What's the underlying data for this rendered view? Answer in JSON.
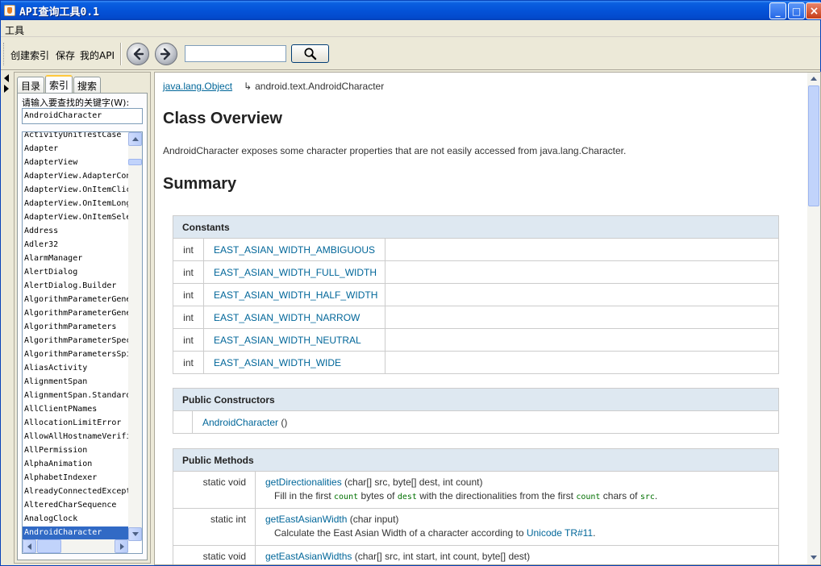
{
  "window": {
    "title": "API查询工具0.1",
    "min": "_",
    "max": "□",
    "close": "×"
  },
  "menu": {
    "tools": "工具"
  },
  "toolbar": {
    "build_index": "创建索引",
    "save": "保存",
    "my_api": "我的API",
    "search_value": ""
  },
  "sidebar": {
    "tabs": [
      "目录",
      "索引",
      "搜索"
    ],
    "active_tab": "索引",
    "keyword_label": "请输入要查找的关键字(W):",
    "keyword_value": "AndroidCharacter",
    "items": [
      "ActivityUnitTestCase",
      "Adapter",
      "AdapterView",
      "AdapterView.AdapterContextMenuInfo",
      "AdapterView.OnItemClickListener",
      "AdapterView.OnItemLongClickListener",
      "AdapterView.OnItemSelectedListener",
      "Address",
      "Adler32",
      "AlarmManager",
      "AlertDialog",
      "AlertDialog.Builder",
      "AlgorithmParameterGenerator",
      "AlgorithmParameterGeneratorSpi",
      "AlgorithmParameters",
      "AlgorithmParameterSpec",
      "AlgorithmParametersSpi",
      "AliasActivity",
      "AlignmentSpan",
      "AlignmentSpan.Standard",
      "AllClientPNames",
      "AllocationLimitError",
      "AllowAllHostnameVerifier",
      "AllPermission",
      "AlphaAnimation",
      "AlphabetIndexer",
      "AlreadyConnectedException",
      "AlteredCharSequence",
      "AnalogClock",
      "AndroidCharacter"
    ],
    "selected_item": "AndroidCharacter"
  },
  "doc": {
    "breadcrumb_parent": "java.lang.Object",
    "breadcrumb_arrow": "↳",
    "breadcrumb_current": "android.text.AndroidCharacter",
    "overview_title": "Class Overview",
    "overview_desc": "AndroidCharacter exposes some character properties that are not easily accessed from java.lang.Character.",
    "summary_title": "Summary",
    "constants": {
      "header": "Constants",
      "rows": [
        {
          "type": "int",
          "name": "EAST_ASIAN_WIDTH_AMBIGUOUS"
        },
        {
          "type": "int",
          "name": "EAST_ASIAN_WIDTH_FULL_WIDTH"
        },
        {
          "type": "int",
          "name": "EAST_ASIAN_WIDTH_HALF_WIDTH"
        },
        {
          "type": "int",
          "name": "EAST_ASIAN_WIDTH_NARROW"
        },
        {
          "type": "int",
          "name": "EAST_ASIAN_WIDTH_NEUTRAL"
        },
        {
          "type": "int",
          "name": "EAST_ASIAN_WIDTH_WIDE"
        }
      ]
    },
    "constructors": {
      "header": "Public Constructors",
      "name": "AndroidCharacter",
      "params": " ()"
    },
    "methods": {
      "header": "Public Methods",
      "rows": [
        {
          "type": "static void",
          "name": "getDirectionalities",
          "params": " (char[] src, byte[] dest, int count)",
          "desc_parts": [
            "Fill in the first ",
            "count",
            " bytes of ",
            "dest",
            " with the directionalities from the first ",
            "count",
            " chars of ",
            "src",
            "."
          ]
        },
        {
          "type": "static int",
          "name": "getEastAsianWidth",
          "params": " (char input)",
          "desc_before": "Calculate the East Asian Width of a character according to ",
          "desc_link": "Unicode TR#11",
          "desc_after": "."
        },
        {
          "type": "static void",
          "name": "getEastAsianWidths",
          "params": " (char[] src, int start, int count, byte[] dest)"
        }
      ]
    }
  }
}
